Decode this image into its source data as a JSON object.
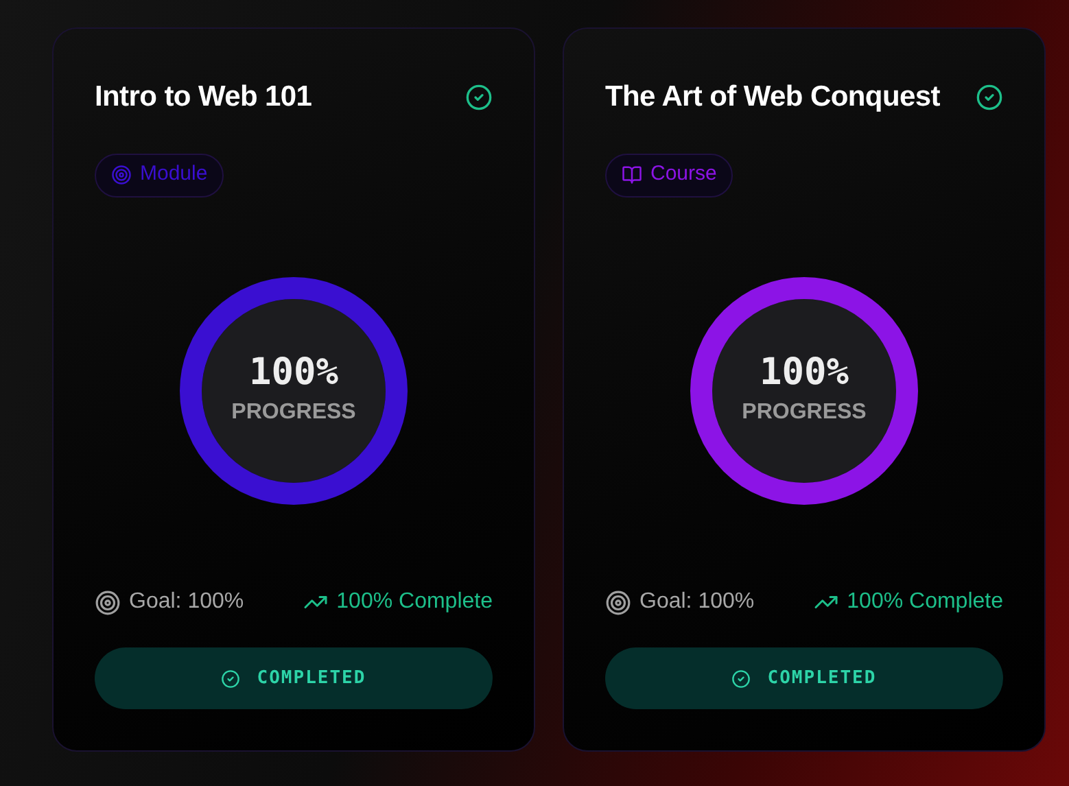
{
  "cards": [
    {
      "title": "Intro to Web 101",
      "done": true,
      "badge": {
        "kind": "module",
        "label": "Module"
      },
      "color": "#3a0fd1",
      "percent": "100%",
      "progress_label": "PROGRESS",
      "goal": "Goal: 100%",
      "complete": "100% Complete",
      "button": "COMPLETED"
    },
    {
      "title": "The Art of Web Conquest",
      "done": true,
      "badge": {
        "kind": "course",
        "label": "Course"
      },
      "color": "#8c14e6",
      "percent": "100%",
      "progress_label": "PROGRESS",
      "goal": "Goal: 100%",
      "complete": "100% Complete",
      "button": "COMPLETED"
    }
  ]
}
